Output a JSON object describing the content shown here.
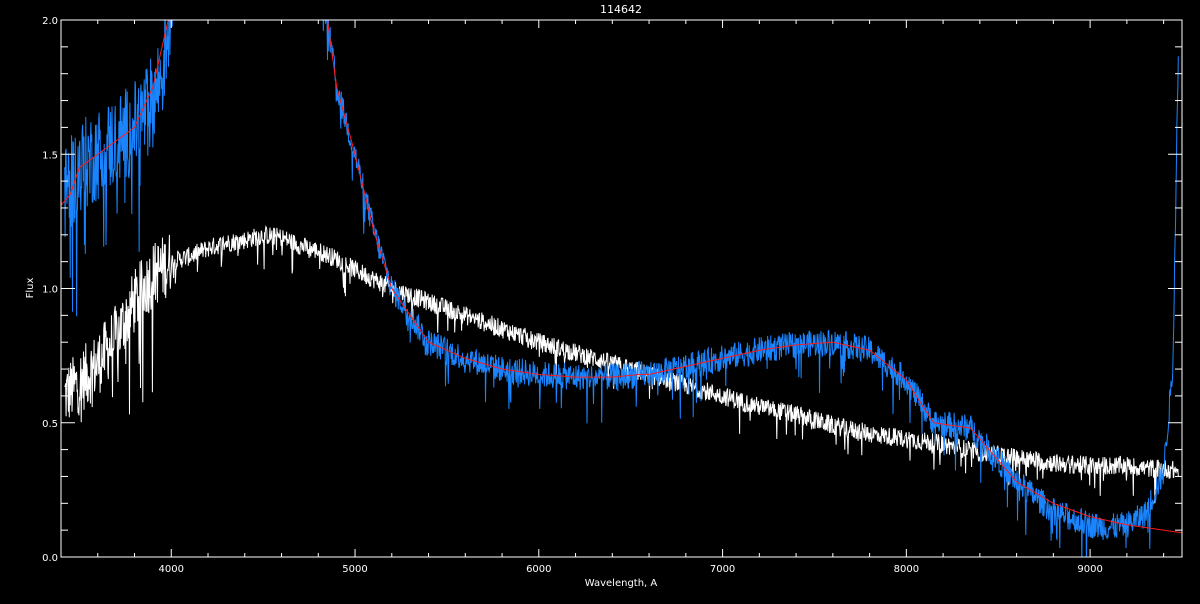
{
  "chart_data": {
    "type": "line",
    "title": "114642",
    "xlabel": "Wavelength, A",
    "ylabel": "Flux",
    "xlim": [
      3400,
      9500
    ],
    "ylim": [
      0.0,
      2.0
    ],
    "x_ticks": [
      4000,
      5000,
      6000,
      7000,
      8000,
      9000
    ],
    "x_tick_labels": [
      "4000",
      "5000",
      "6000",
      "7000",
      "8000",
      "9000"
    ],
    "y_ticks": [
      0.0,
      0.5,
      1.0,
      1.5,
      2.0
    ],
    "y_tick_labels": [
      "0.0",
      "0.5",
      "1.0",
      "1.5",
      "2.0"
    ],
    "grid": false,
    "background": "#000000",
    "axis_color": "#ffffff",
    "series": [
      {
        "color": "#ffffff",
        "noise": 0.035,
        "x": [
          3420,
          3500,
          3600,
          3700,
          3800,
          3900,
          4000,
          4100,
          4200,
          4300,
          4400,
          4500,
          4600,
          4700,
          4800,
          4900,
          5000,
          5200,
          5400,
          5600,
          5800,
          6000,
          6200,
          6400,
          6550,
          6600,
          6800,
          7000,
          7200,
          7400,
          7600,
          7800,
          8000,
          8200,
          8400,
          8600,
          8800,
          9000,
          9200,
          9300,
          9400,
          9480
        ],
        "y": [
          0.6,
          0.65,
          0.72,
          0.82,
          0.95,
          1.05,
          1.1,
          1.12,
          1.15,
          1.17,
          1.18,
          1.2,
          1.19,
          1.16,
          1.14,
          1.11,
          1.07,
          1.0,
          0.95,
          0.9,
          0.85,
          0.8,
          0.76,
          0.72,
          0.69,
          0.68,
          0.64,
          0.6,
          0.56,
          0.53,
          0.49,
          0.46,
          0.44,
          0.42,
          0.39,
          0.37,
          0.35,
          0.34,
          0.34,
          0.33,
          0.33,
          0.32
        ]
      },
      {
        "color": "#1a85ff",
        "noise": 0.05,
        "x": [
          3420,
          3500,
          3600,
          3700,
          3800,
          3900,
          3950,
          4000,
          4200,
          4400,
          4600,
          4800,
          4850,
          4900,
          5000,
          5100,
          5200,
          5400,
          5600,
          5800,
          6000,
          6200,
          6400,
          6550,
          6600,
          6800,
          7000,
          7200,
          7400,
          7600,
          7800,
          8000,
          8100,
          8150,
          8250,
          8350,
          8450,
          8600,
          8800,
          9000,
          9100,
          9200,
          9300,
          9400,
          9450,
          9480
        ],
        "y": [
          1.35,
          1.45,
          1.5,
          1.55,
          1.6,
          1.7,
          1.8,
          2.05,
          2.3,
          2.4,
          2.3,
          2.15,
          2.0,
          1.75,
          1.5,
          1.22,
          1.0,
          0.8,
          0.74,
          0.7,
          0.68,
          0.67,
          0.67,
          0.68,
          0.68,
          0.71,
          0.74,
          0.77,
          0.79,
          0.8,
          0.77,
          0.66,
          0.55,
          0.5,
          0.49,
          0.48,
          0.4,
          0.28,
          0.17,
          0.12,
          0.11,
          0.12,
          0.16,
          0.32,
          0.7,
          1.9
        ]
      },
      {
        "color": "#ff1a1a",
        "noise": 0.0,
        "x": [
          3400,
          3450,
          3500,
          3600,
          3700,
          3800,
          3900,
          3950,
          4000,
          4200,
          4400,
          4600,
          4800,
          4850,
          4900,
          5000,
          5100,
          5200,
          5400,
          5600,
          5800,
          6000,
          6200,
          6400,
          6550,
          6600,
          6800,
          7000,
          7200,
          7400,
          7600,
          7800,
          8000,
          8100,
          8150,
          8250,
          8350,
          8450,
          8600,
          8800,
          9000,
          9200,
          9400,
          9500
        ],
        "y": [
          1.31,
          1.35,
          1.45,
          1.5,
          1.55,
          1.6,
          1.75,
          1.9,
          2.05,
          2.3,
          2.4,
          2.3,
          2.15,
          2.0,
          1.75,
          1.5,
          1.22,
          1.0,
          0.8,
          0.74,
          0.7,
          0.68,
          0.67,
          0.67,
          0.68,
          0.68,
          0.71,
          0.74,
          0.77,
          0.79,
          0.8,
          0.77,
          0.66,
          0.55,
          0.5,
          0.49,
          0.48,
          0.4,
          0.28,
          0.2,
          0.15,
          0.12,
          0.1,
          0.09
        ]
      }
    ]
  }
}
